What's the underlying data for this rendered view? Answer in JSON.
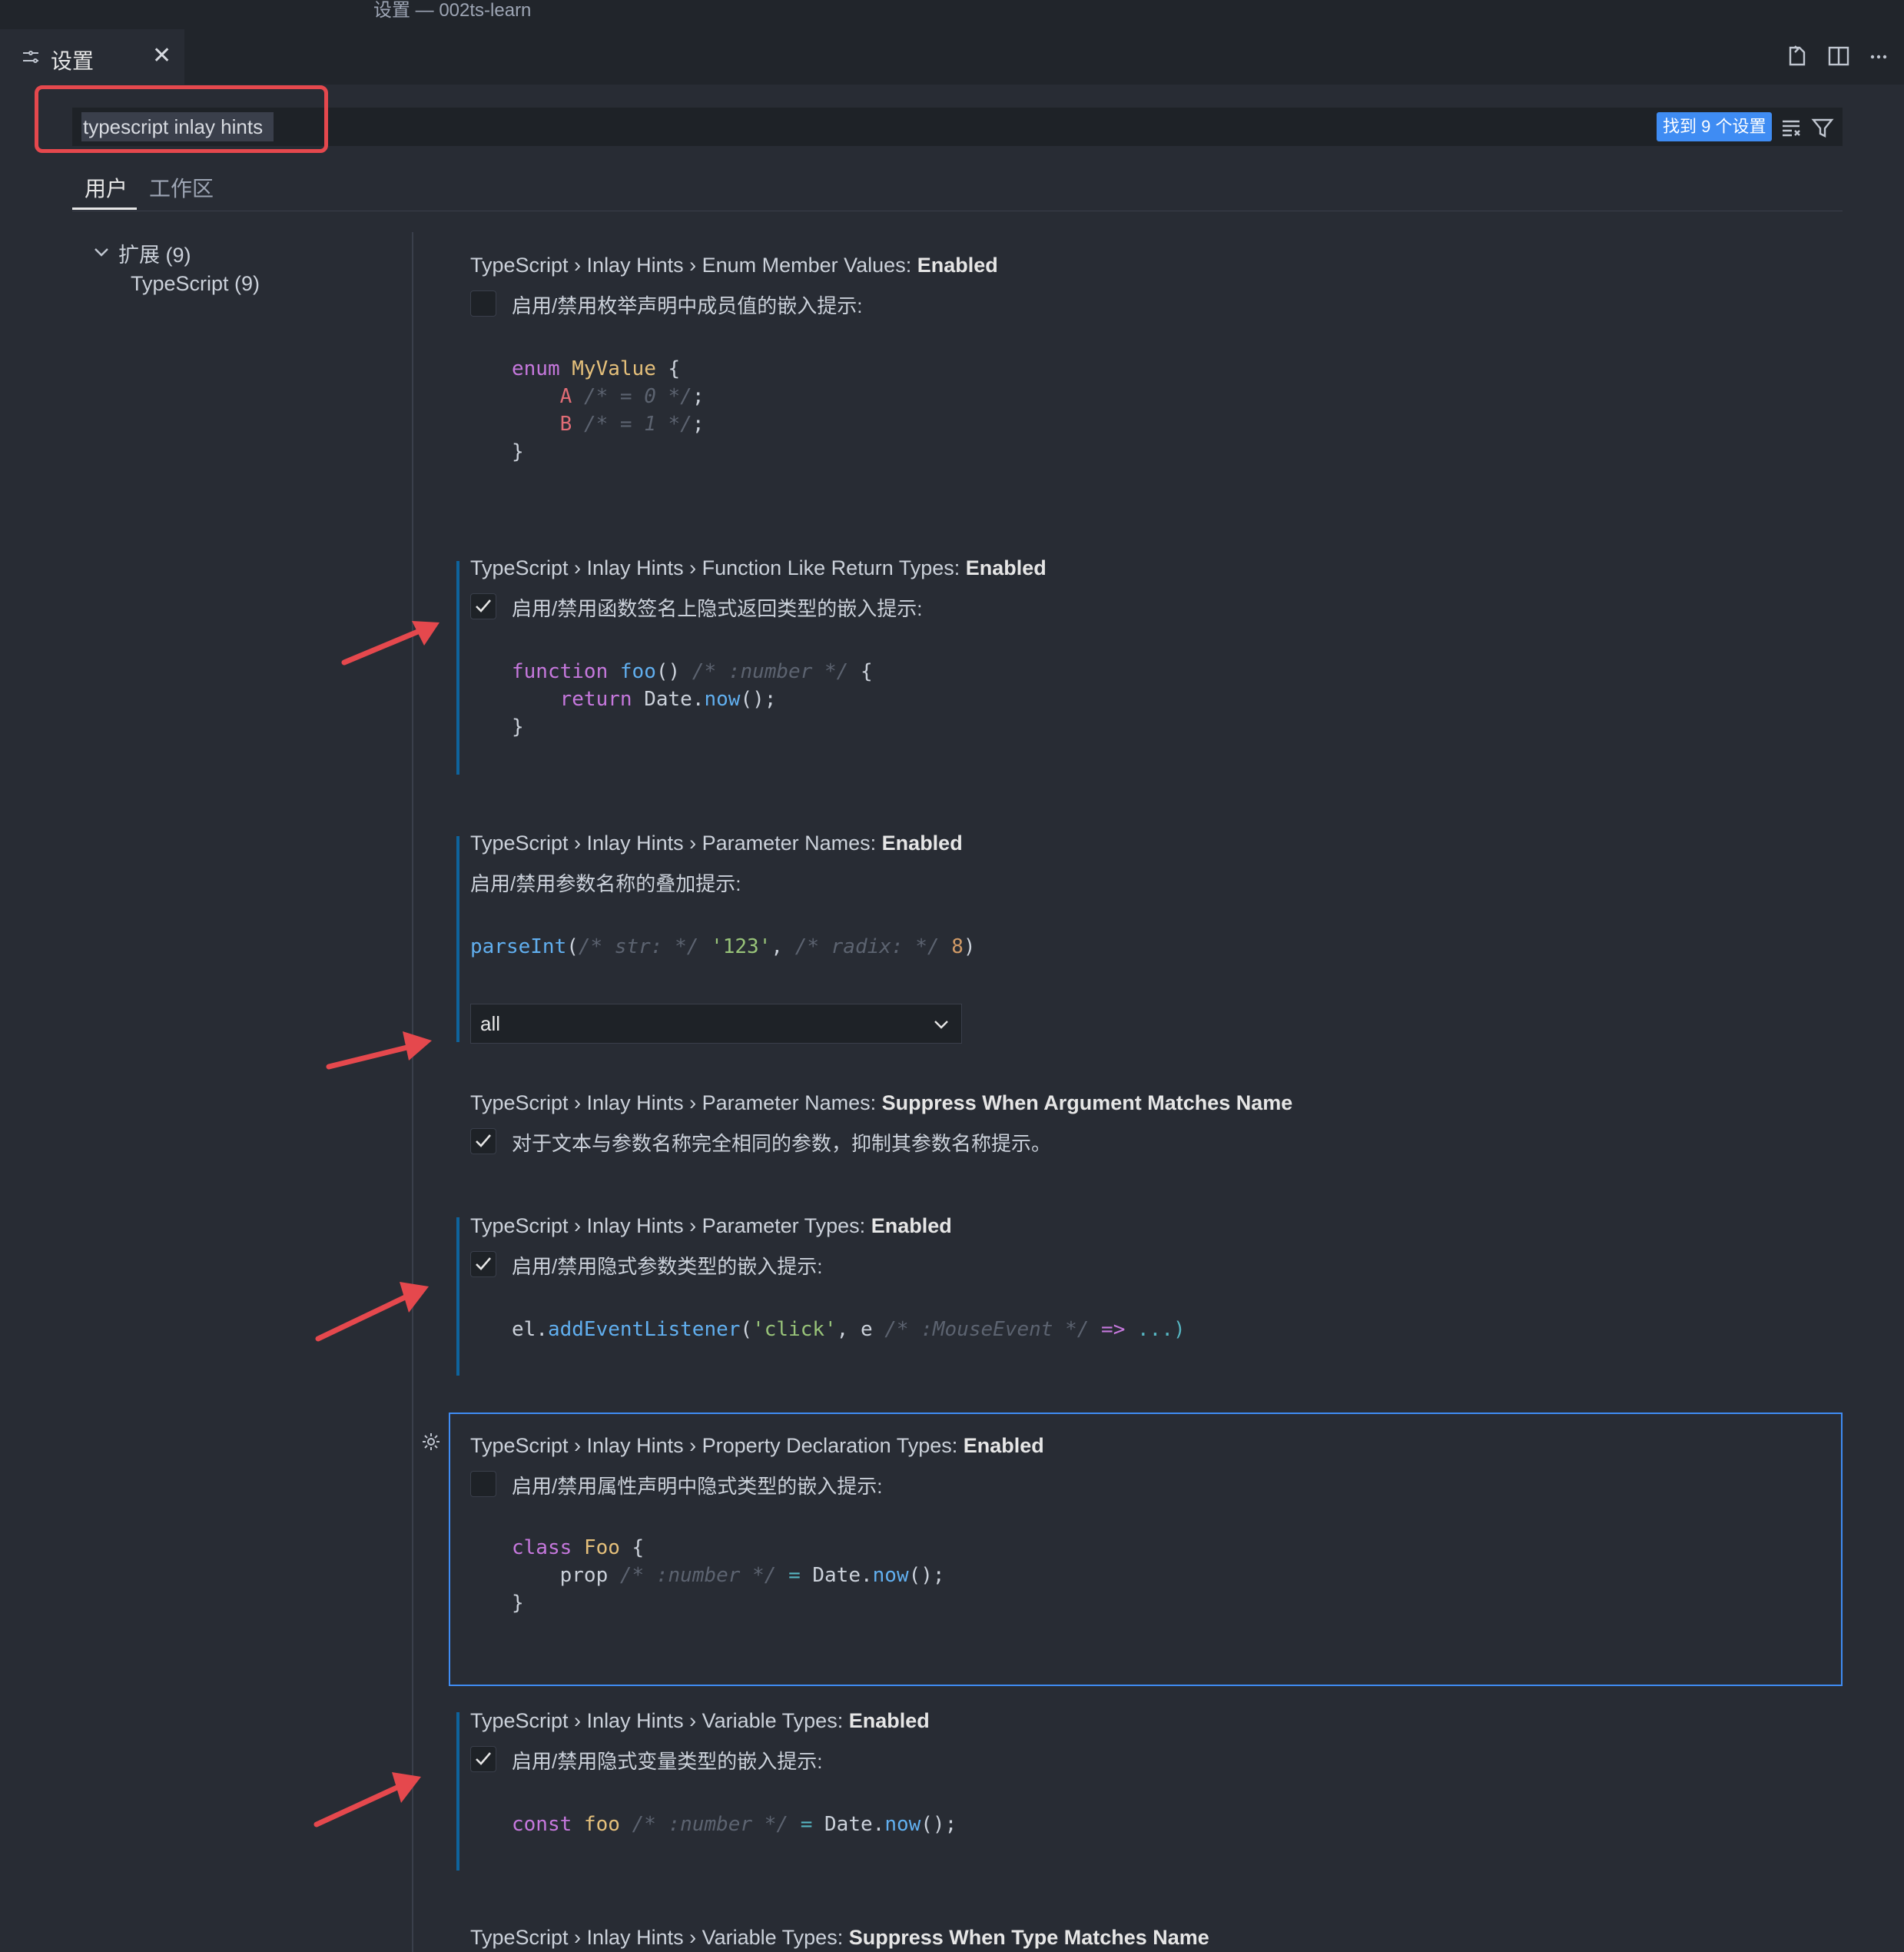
{
  "window": {
    "title": "设置 — 002ts-learn"
  },
  "tab": {
    "label": "设置"
  },
  "search": {
    "value": "typescript inlay hints",
    "result_count": "找到 9 个设置"
  },
  "scopes": {
    "user": "用户",
    "workspace": "工作区"
  },
  "tree": {
    "extensions": "扩展 (9)",
    "typescript": "TypeScript (9)"
  },
  "settings": [
    {
      "prefix": "TypeScript › Inlay Hints › Enum Member Values: ",
      "name": "Enabled",
      "desc": "启用/禁用枚举声明中成员值的嵌入提示:",
      "checked": false
    },
    {
      "prefix": "TypeScript › Inlay Hints › Function Like Return Types: ",
      "name": "Enabled",
      "desc": "启用/禁用函数签名上隐式返回类型的嵌入提示:",
      "checked": true
    },
    {
      "prefix": "TypeScript › Inlay Hints › Parameter Names: ",
      "name": "Enabled",
      "desc": "启用/禁用参数名称的叠加提示:",
      "value": "all"
    },
    {
      "prefix": "TypeScript › Inlay Hints › Parameter Names: ",
      "name": "Suppress When Argument Matches Name",
      "desc": "对于文本与参数名称完全相同的参数，抑制其参数名称提示。",
      "checked": true
    },
    {
      "prefix": "TypeScript › Inlay Hints › Parameter Types: ",
      "name": "Enabled",
      "desc": "启用/禁用隐式参数类型的嵌入提示:",
      "checked": true
    },
    {
      "prefix": "TypeScript › Inlay Hints › Property Declaration Types: ",
      "name": "Enabled",
      "desc": "启用/禁用属性声明中隐式类型的嵌入提示:",
      "checked": false
    },
    {
      "prefix": "TypeScript › Inlay Hints › Variable Types: ",
      "name": "Enabled",
      "desc": "启用/禁用隐式变量类型的嵌入提示:",
      "checked": true
    },
    {
      "prefix": "TypeScript › Inlay Hints › Variable Types: ",
      "name": "Suppress When Type Matches Name"
    }
  ],
  "code": {
    "enum": {
      "kw": "enum",
      "type": "MyValue",
      "a": "A",
      "a_hint": "/* = 0 */",
      "b": "B",
      "b_hint": "/* = 1 */"
    },
    "func": {
      "kw": "function",
      "name": "foo",
      "hint": "/* :number */",
      "ret": "return",
      "obj": "Date",
      "call": "now"
    },
    "param": {
      "fn": "parseInt",
      "hint1": "/* str: */",
      "arg1": "'123'",
      "hint2": "/* radix: */",
      "arg2": "8"
    },
    "ptype": {
      "obj": "el",
      "fn": "addEventListener",
      "arg": "'click'",
      "param": "e",
      "hint": "/* :MouseEvent */",
      "arrow": "=>",
      "rest": "...)"
    },
    "prop": {
      "kw": "class",
      "type": "Foo",
      "field": "prop",
      "hint": "/* :number */",
      "obj": "Date",
      "call": "now"
    },
    "var": {
      "kw": "const",
      "name": "foo",
      "hint": "/* :number */",
      "obj": "Date",
      "call": "now"
    }
  },
  "colors": {
    "accent": "#3f8cf3",
    "annotation": "#e5484d",
    "modified": "#0e639c"
  }
}
